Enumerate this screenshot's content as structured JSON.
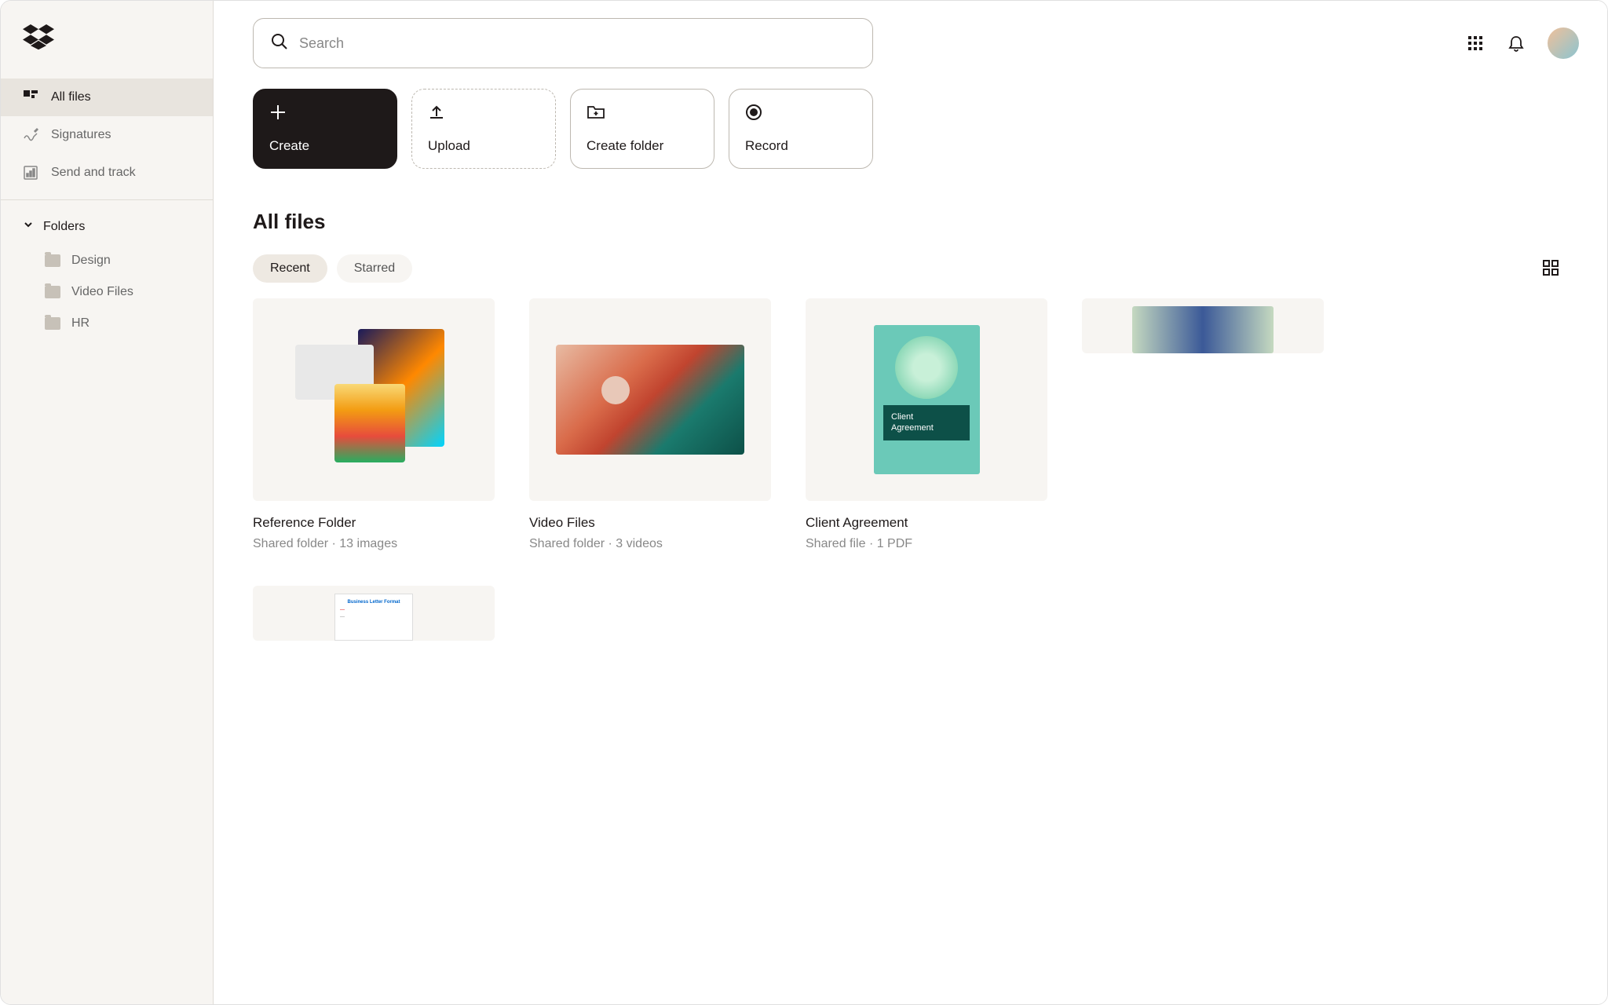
{
  "sidebar": {
    "nav": [
      {
        "label": "All files",
        "icon": "all-files",
        "active": true
      },
      {
        "label": "Signatures",
        "icon": "signatures",
        "active": false
      },
      {
        "label": "Send and track",
        "icon": "send-track",
        "active": false
      }
    ],
    "folders_header": "Folders",
    "folders": [
      {
        "label": "Design"
      },
      {
        "label": "Video Files"
      },
      {
        "label": "HR"
      }
    ]
  },
  "search": {
    "placeholder": "Search"
  },
  "actions": [
    {
      "label": "Create",
      "style": "primary",
      "icon": "plus"
    },
    {
      "label": "Upload",
      "style": "dashed",
      "icon": "upload"
    },
    {
      "label": "Create folder",
      "style": "outline",
      "icon": "folder-plus"
    },
    {
      "label": "Record",
      "style": "outline",
      "icon": "record"
    }
  ],
  "page_title": "All files",
  "filters": [
    {
      "label": "Recent",
      "active": true
    },
    {
      "label": "Starred",
      "active": false
    }
  ],
  "cards": [
    {
      "title": "Reference Folder",
      "subtitle": "Shared folder · 13 images",
      "thumb": "stack"
    },
    {
      "title": "Video Files",
      "subtitle": "Shared folder · 3 videos",
      "thumb": "waves"
    },
    {
      "title": "Client Agreement",
      "subtitle": "Shared file · 1 PDF",
      "thumb": "doc",
      "doc_label_line1": "Client",
      "doc_label_line2": "Agreement"
    },
    {
      "title": "",
      "subtitle": "",
      "thumb": "small"
    },
    {
      "title": "",
      "subtitle": "",
      "thumb": "letter",
      "letter_heading": "Business Letter Format"
    }
  ]
}
